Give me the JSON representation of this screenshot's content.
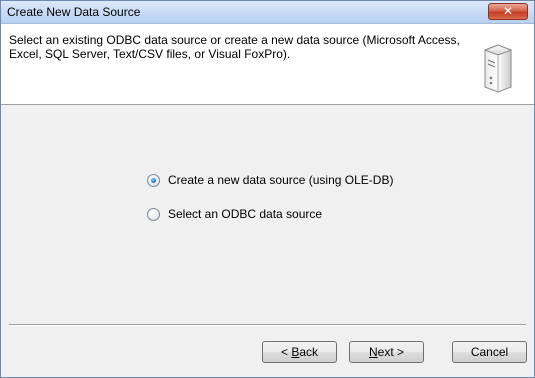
{
  "window": {
    "title": "Create New Data Source"
  },
  "header": {
    "description": "Select an existing ODBC data source or create a new data source (Microsoft Access, Excel, SQL Server, Text/CSV files, or Visual FoxPro).",
    "icon": "database-server-icon"
  },
  "options": {
    "selected": "ole-db",
    "items": [
      {
        "label": "Create a new data source (using OLE-DB)",
        "checked": true
      },
      {
        "label": "Select an ODBC data source",
        "checked": false
      }
    ]
  },
  "buttons": {
    "back_mnemonic": "B",
    "back_rest": "ack",
    "back_prefix": "< ",
    "next_mnemonic": "N",
    "next_rest": "ext >",
    "cancel": "Cancel"
  }
}
